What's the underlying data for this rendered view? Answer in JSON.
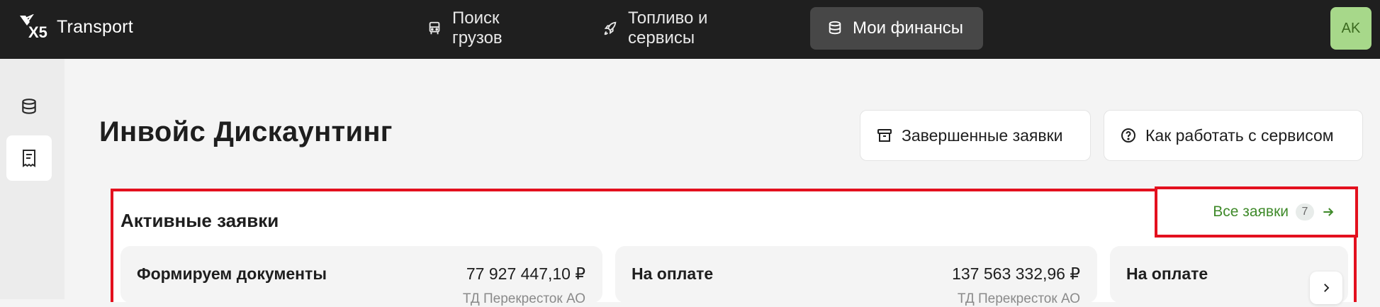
{
  "brand": {
    "name": "Transport",
    "logo_mark": "X5"
  },
  "nav": {
    "items": [
      {
        "label": "Поиск грузов",
        "icon": "truck-icon"
      },
      {
        "label": "Топливо и сервисы",
        "icon": "rocket-icon"
      },
      {
        "label": "Мои финансы",
        "icon": "database-icon",
        "active": true
      }
    ]
  },
  "user": {
    "initials": "AK"
  },
  "sidebar": {
    "items": [
      {
        "icon": "database-icon"
      },
      {
        "icon": "document-icon",
        "active": true
      }
    ]
  },
  "page": {
    "title": "Инвойс Дискаунтинг",
    "completed_button": "Завершенные заявки",
    "help_button": "Как работать с сервисом"
  },
  "active_requests": {
    "title": "Активные заявки",
    "all_link": "Все заявки",
    "count": "7",
    "cards": [
      {
        "title": "Формируем документы",
        "amount": "77 927 447,10 ₽",
        "company": "ТД Перекресток АО"
      },
      {
        "title": "На оплате",
        "amount": "137 563 332,96 ₽",
        "company": "ТД Перекресток АО"
      },
      {
        "title": "На оплате",
        "amount": "",
        "company": ""
      }
    ]
  },
  "colors": {
    "topbar": "#1f1f1f",
    "accent_green": "#3f8a2a",
    "highlight_red": "#e3101e",
    "avatar_bg": "#a7d88a"
  }
}
